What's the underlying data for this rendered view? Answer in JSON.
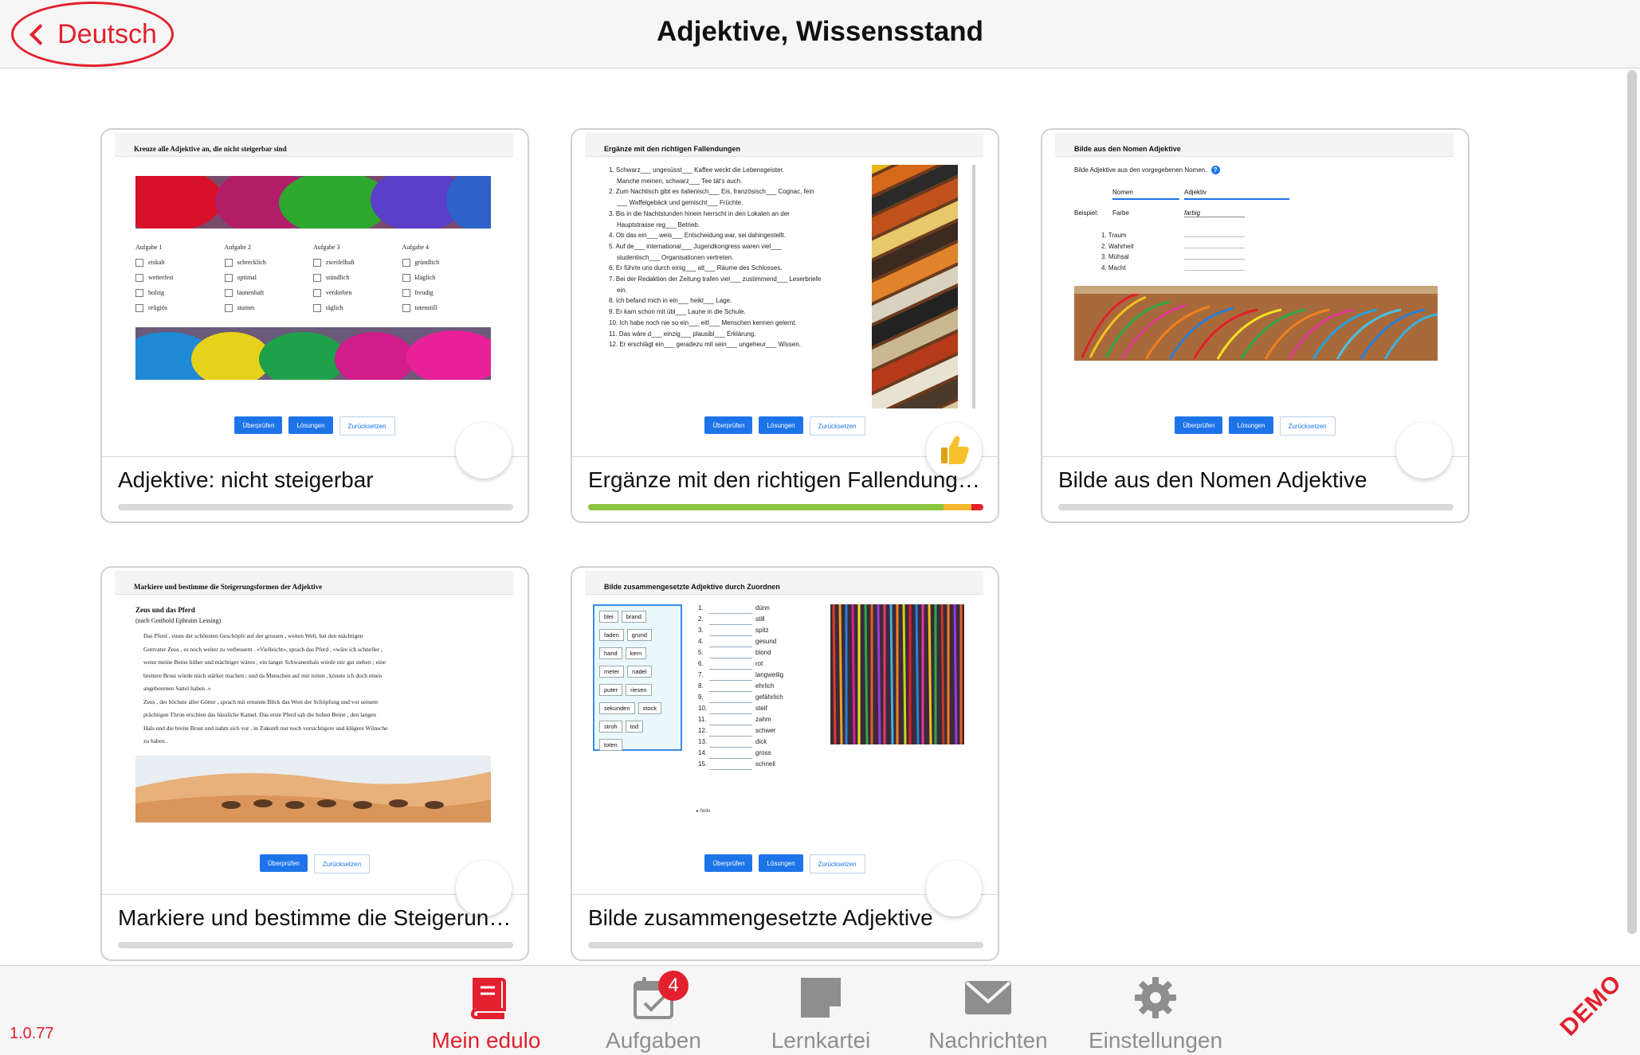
{
  "header": {
    "back_label": "Deutsch",
    "title": "Adjektive, Wissensstand"
  },
  "cards": [
    {
      "title": "Adjektive: nicht steigerbar",
      "sheet_title": "Kreuze alle Adjektive an, die nicht steigerbar sind",
      "buttons": [
        "Überprüfen",
        "Lösungen",
        "Zurücksetzen"
      ],
      "aufgaben": [
        {
          "label": "Aufgabe 1",
          "items": [
            "eiskalt",
            "wetterfest",
            "holzig",
            "religiös"
          ]
        },
        {
          "label": "Aufgabe 2",
          "items": [
            "schrecklich",
            "optimal",
            "launenhaft",
            "stumm"
          ]
        },
        {
          "label": "Aufgabe 3",
          "items": [
            "zweifelhaft",
            "stündlich",
            "verdorben",
            "täglich"
          ]
        },
        {
          "label": "Aufgabe 4",
          "items": [
            "gründlich",
            "kläglich",
            "freudig",
            "totenstill"
          ]
        }
      ],
      "progress": [
        {
          "color": "#d9d9d9",
          "value": 1.0
        }
      ]
    },
    {
      "title": "Ergänze mit den richtigen Fallendungen",
      "sheet_title": "Ergänze mit den richtigen Fallendungen",
      "buttons": [
        "Überprüfen",
        "Lösungen",
        "Zurücksetzen"
      ],
      "lines": [
        "1. Schwarz___ ungesüsst___ Kaffee weckt die Lebensgeister.",
        "Manche meinen, schwarz___ Tee tät's auch.",
        "2. Zum Nachtisch gibt es italienisch___ Eis, französisch___ Cognac, fein",
        "___ Waffelgebäck und gemischt___ Früchte.",
        "3. Bis in die Nachtstunden hinein herrscht in den Lokalen an der",
        "Hauptstrasse reg___ Betrieb.",
        "4. Ob das ein___ weis___ Entscheidung war, sei dahingestellt.",
        "5. Auf de___ international___ Jugendkongress waren viel___",
        "studentisch___ Organisationen vertreten.",
        "6. Er führte uns durch einig___ alt___ Räume des Schlosses.",
        "7. Bei der Redaktion der Zeitung trafen viel___ zustimmend___ Leserbriefe",
        "ein.",
        "8. Ich befand mich in ein___ heikl___ Lage.",
        "9. Er kam schon mit übl___ Laune in die Schule.",
        "10. Ich habe noch nie so ein___ eitl___ Menschen kennen gelernt.",
        "11. Das wäre d___ einzig___ plausibl___ Erklärung.",
        "12. Er erschlägt ein___ geradezu mit sein___ ungeheur___ Wissen."
      ],
      "progress": [
        {
          "color": "#8cc63f",
          "value": 0.9
        },
        {
          "color": "#f5b82e",
          "value": 0.07
        },
        {
          "color": "#e3202d",
          "value": 0.03
        }
      ]
    },
    {
      "title": "Bilde aus den Nomen Adjektive",
      "sheet_title": "Bilde aus den Nomen Adjektive",
      "buttons": [
        "Überprüfen",
        "Lösungen",
        "Zurücksetzen"
      ],
      "instruction": "Bilde Adjektive aus den vorgegebenen Nomen.",
      "col_nomen": "Nomen",
      "col_adjektiv": "Adjektiv",
      "example_label": "Beispiel:",
      "example_noun": "Farbe",
      "example_adj": "farbig",
      "items": [
        "1. Traum",
        "2. Wahrheit",
        "3. Mühsal",
        "4. Macht"
      ],
      "progress": [
        {
          "color": "#d9d9d9",
          "value": 1.0
        }
      ]
    },
    {
      "title": "Markiere und bestimme die Steigerungsformen",
      "sheet_title": "Markiere und bestimme die Steigerungsformen der Adjektive",
      "buttons": [
        "Überprüfen",
        "Zurücksetzen"
      ],
      "story_title": "Zeus und das Pferd",
      "story_author": "(nach Gotthold Ephraim Lessing)",
      "lines": [
        "Das Pferd , eines der schönsten Geschöpfe auf der grossen , weiten Welt, bat den mächtigen",
        "Gottvater Zeus , es noch weiter zu verbessern . «Vielleicht», sprach das Pferd , «wäre ich schneller ,",
        "wenn meine Beine höher und mächtiger wären ; ein langer Schwanenhals würde mir gut stehen ; eine",
        "breitere Brust würde mich stärker machen ; und da Menschen auf mir reiten , könnte ich doch einen",
        "angeborenen Sattel haben .»",
        "Zeus , der höchste aller Götter , sprach mit ernstem Blick das Wort der Schöpfung und vor seinem",
        "prächtigen Thron erschien das hässliche Kamel. Das erste Pferd sah die hohen Beine , den langen",
        "Hals und die breite Brust und nahm sich vor , in Zukunft nur noch vorsichtigere und klügere Wünsche",
        "zu haben ."
      ],
      "progress": [
        {
          "color": "#d9d9d9",
          "value": 1.0
        }
      ]
    },
    {
      "title": "Bilde zusammengesetzte Adjektive",
      "sheet_title": "Bilde zusammengesetzte Adjektive durch Zuordnen",
      "buttons": [
        "Überprüfen",
        "Lösungen",
        "Zurücksetzen"
      ],
      "chips": [
        [
          "blei",
          "brand"
        ],
        [
          "faden",
          "grund"
        ],
        [
          "hand",
          "kern"
        ],
        [
          "meter",
          "nadel"
        ],
        [
          "puter",
          "riesen"
        ],
        [
          "sekunden",
          "stock"
        ],
        [
          "stroh",
          "tod"
        ],
        [
          "toten"
        ]
      ],
      "rows": [
        "dünn",
        "still",
        "spitz",
        "gesund",
        "blond",
        "rot",
        "langweilig",
        "ehrlich",
        "gefährlich",
        "steif",
        "zahm",
        "schwer",
        "dick",
        "gross",
        "schnell"
      ],
      "hint": "▸ hello",
      "progress": [
        {
          "color": "#d9d9d9",
          "value": 1.0
        }
      ]
    }
  ],
  "footer": {
    "version": "1.0.77",
    "tabs": [
      {
        "label": "Mein edulo",
        "icon": "book-icon",
        "active": true
      },
      {
        "label": "Aufgaben",
        "icon": "calendar-check-icon",
        "badge": "4"
      },
      {
        "label": "Lernkartei",
        "icon": "flashcard-icon"
      },
      {
        "label": "Nachrichten",
        "icon": "envelope-icon"
      },
      {
        "label": "Einstellungen",
        "icon": "gear-icon"
      }
    ],
    "demo": "DEMO"
  },
  "colors": {
    "accent": "#e3202d",
    "button_blue": "#1d74e8"
  }
}
